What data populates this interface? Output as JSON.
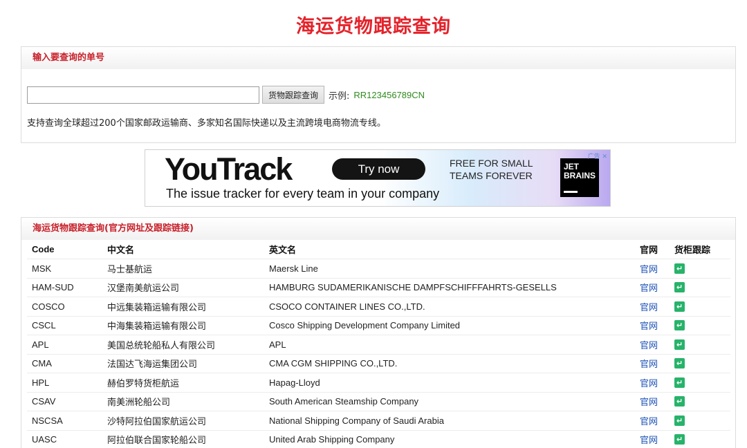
{
  "page": {
    "title": "海运货物跟踪查询"
  },
  "search": {
    "heading": "输入要查询的单号",
    "input_value": "",
    "button_label": "货物跟踪查询",
    "example_label": "示例:",
    "example_value": "RR123456789CN",
    "support_text": "支持查询全球超过200个国家邮政运输商、多家知名国际快递以及主流跨境电商物流专线。"
  },
  "ad": {
    "logo": "YouTrack",
    "cta": "Try now",
    "free_line1": "FREE FOR SMALL",
    "free_line2": "TEAMS FOREVER",
    "tagline": "The issue tracker for every team in your company",
    "brand_line1": "JET",
    "brand_line2": "BRAINS",
    "badge": "广告",
    "close_glyph": "✕"
  },
  "carriers": {
    "heading": "海运货物跟踪查询(官方网址及跟踪链接)",
    "columns": {
      "code": "Code",
      "cn": "中文名",
      "en": "英文名",
      "site": "官网",
      "track": "货柜跟踪"
    },
    "rows": [
      {
        "code": "MSK",
        "cn": "马士基航运",
        "en": "Maersk Line",
        "site": "官网"
      },
      {
        "code": "HAM-SUD",
        "cn": "汉堡南美航运公司",
        "en": "HAMBURG SUDAMERIKANISCHE DAMPFSCHIFFFAHRTS-GESELLS",
        "site": "官网"
      },
      {
        "code": "COSCO",
        "cn": "中远集装箱运输有限公司",
        "en": "CSOCO CONTAINER LINES CO.,LTD.",
        "site": "官网"
      },
      {
        "code": "CSCL",
        "cn": "中海集装箱运输有限公司",
        "en": "Cosco Shipping Development Company Limited",
        "site": "官网"
      },
      {
        "code": "APL",
        "cn": "美国总统轮船私人有限公司",
        "en": "APL",
        "site": "官网"
      },
      {
        "code": "CMA",
        "cn": "法国达飞海运集团公司",
        "en": "CMA CGM SHIPPING CO.,LTD.",
        "site": "官网"
      },
      {
        "code": "HPL",
        "cn": "赫伯罗特货柜航运",
        "en": "Hapag-Lloyd",
        "site": "官网"
      },
      {
        "code": "CSAV",
        "cn": "南美洲轮船公司",
        "en": "South American Steamship Company",
        "site": "官网"
      },
      {
        "code": "NSCSA",
        "cn": "沙特阿拉伯国家航运公司",
        "en": "National Shipping Company of Saudi Arabia",
        "site": "官网"
      },
      {
        "code": "UASC",
        "cn": "阿拉伯联合国家轮船公司",
        "en": "United Arab Shipping Company",
        "site": "官网"
      }
    ],
    "track_icon_glyph": "↵"
  }
}
